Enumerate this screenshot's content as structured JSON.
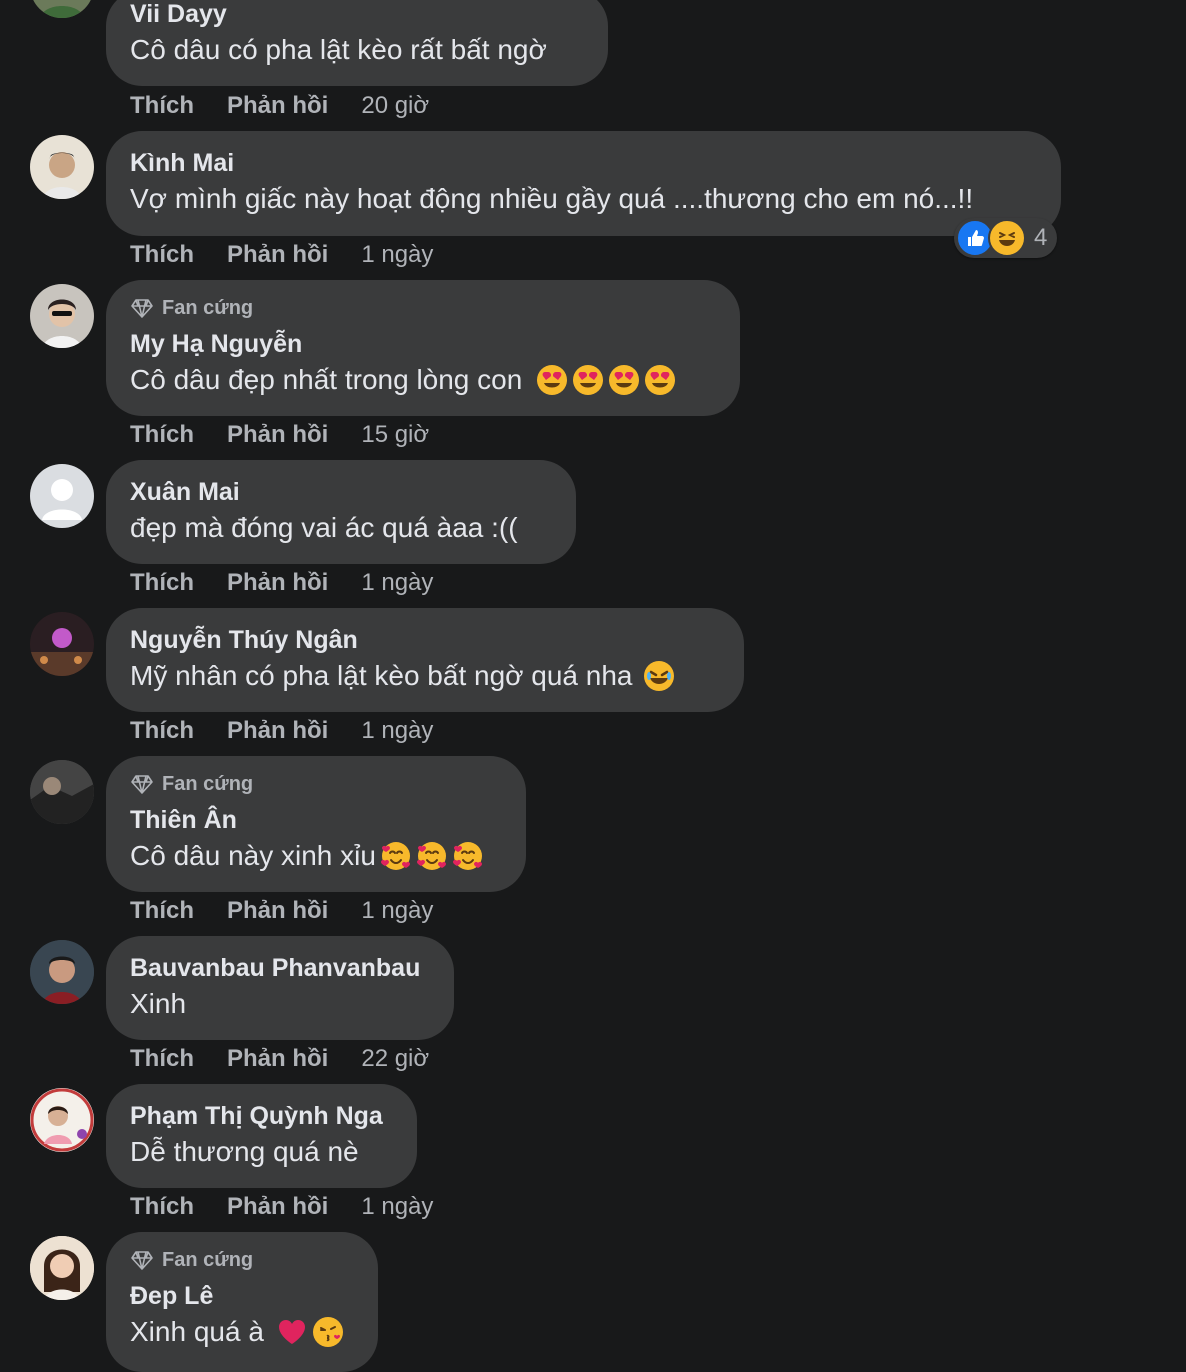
{
  "labels": {
    "like": "Thích",
    "reply": "Phản hồi"
  },
  "comments": [
    {
      "author": "Vii Dayy",
      "text": "Cô dâu có pha lật kèo rất bất ngờ",
      "time": "20 giờ",
      "badge": ""
    },
    {
      "author": "Kình Mai",
      "text": "Vợ mình giấc này hoạt động nhiều gầy quá ....thương cho em nó...!!",
      "time": "1 ngày",
      "badge": "",
      "reaction_count": "4"
    },
    {
      "author": "My Hạ Nguyễn",
      "text": "Cô dâu đẹp nhất trong lòng con",
      "time": "15 giờ",
      "badge": "Fan cứng"
    },
    {
      "author": "Xuân Mai",
      "text": "đẹp mà đóng vai ác quá àaa :((",
      "time": "1 ngày",
      "badge": ""
    },
    {
      "author": "Nguyễn Thúy Ngân",
      "text": "Mỹ nhân có pha lật kèo bất ngờ quá nha",
      "time": "1 ngày",
      "badge": ""
    },
    {
      "author": "Thiên Ân",
      "text": "Cô dâu này xinh xỉu",
      "time": "1 ngày",
      "badge": "Fan cứng"
    },
    {
      "author": "Bauvanbau Phanvanbau",
      "text": "Xinh",
      "time": "22 giờ",
      "badge": ""
    },
    {
      "author": "Phạm Thị Quỳnh Nga",
      "text": "Dễ thương quá nè",
      "time": "1 ngày",
      "badge": ""
    },
    {
      "author": "Đep Lê",
      "text": "Xinh quá à",
      "time": "",
      "badge": "Fan cứng"
    }
  ],
  "icons": {
    "badge": "diamond-icon",
    "like_reaction": "like-reaction-icon",
    "haha_reaction": "haha-reaction-icon",
    "heart_eyes": "heart-eyes-emoji-icon",
    "rofl": "rofl-emoji-icon",
    "smiling_hearts": "smiling-hearts-emoji-icon",
    "red_heart": "red-heart-emoji-icon",
    "kiss": "kiss-emoji-icon"
  },
  "colors": {
    "background": "#18191a",
    "bubble": "#3a3b3c",
    "text": "#e4e6eb",
    "secondary": "#b0b3b8",
    "like_blue": "#1877f2"
  }
}
